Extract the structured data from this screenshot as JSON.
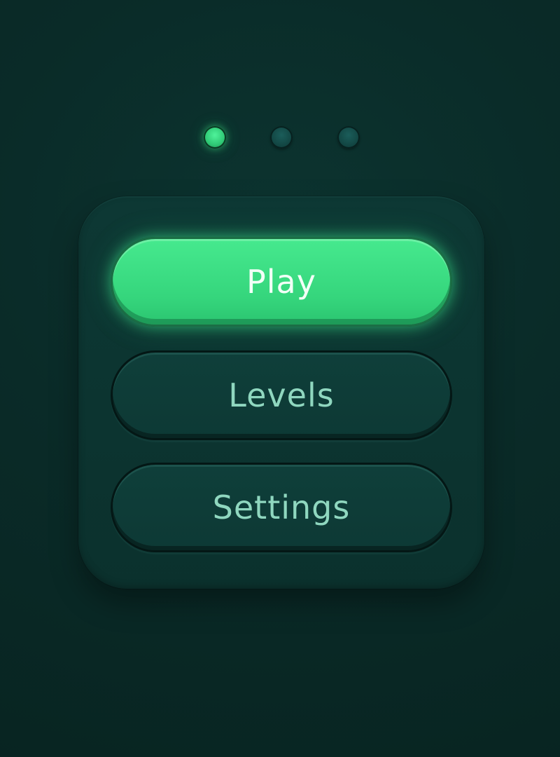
{
  "menu": {
    "page_indicators": [
      {
        "state": "active"
      },
      {
        "state": "inactive"
      },
      {
        "state": "inactive"
      }
    ],
    "buttons": {
      "play": "Play",
      "levels": "Levels",
      "settings": "Settings"
    }
  },
  "colors": {
    "background": "#0a2b28",
    "panel": "#0d3834",
    "accent_green": "#3fe087",
    "button_text_dark": "#8fd7bf",
    "button_text_light": "#f2fff7"
  }
}
